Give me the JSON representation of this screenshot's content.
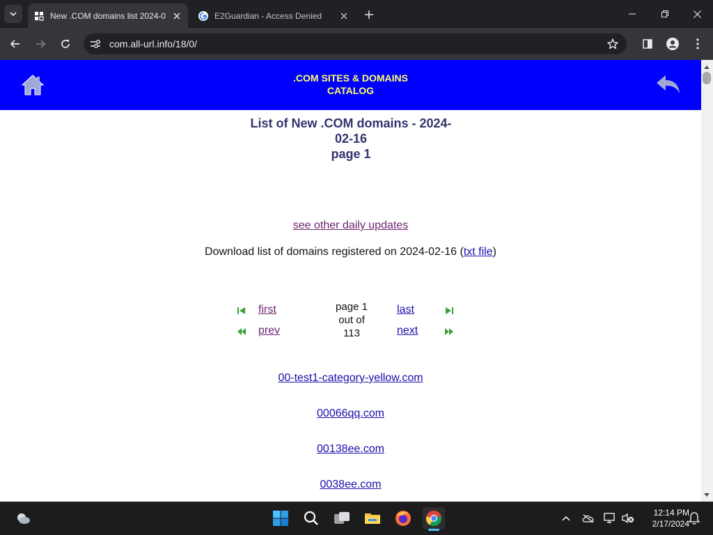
{
  "browser": {
    "tabs": [
      {
        "title": "New .COM domains list 2024-0",
        "favicon": "page-grid-icon",
        "active": true
      },
      {
        "title": "E2Guardian - Access Denied",
        "favicon": "google-g-icon",
        "active": false
      }
    ],
    "url": "com.all-url.info/18/0/"
  },
  "page": {
    "banner": {
      "title_line1": ".COM SITES & DOMAINS",
      "title_line2": "CATALOG",
      "left_icon": "home-icon",
      "right_icon": "back-arrow-icon"
    },
    "heading": {
      "line1": "List of New .COM domains - 2024-",
      "line2": "02-16",
      "line3": "page 1"
    },
    "daily_updates_link": "see other daily updates",
    "download": {
      "prefix": "Download list of domains registered on 2024-02-16 (",
      "link": "txt file",
      "suffix": ")"
    },
    "pager": {
      "first": "first",
      "prev": "prev",
      "last": "last",
      "next": "next",
      "info_line1": "page 1",
      "info_line2": "out of",
      "info_line3": "113"
    },
    "domains": [
      "00-test1-category-yellow.com",
      "00066qq.com",
      "00138ee.com",
      "0038ee.com"
    ]
  },
  "taskbar": {
    "apps": [
      "start-icon",
      "search-icon",
      "task-view-icon",
      "file-explorer-icon",
      "firefox-icon",
      "chrome-icon"
    ],
    "time": "12:14 PM",
    "date": "2/17/2024"
  },
  "colors": {
    "banner_bg": "#0000ff",
    "banner_text": "#ffff66",
    "heading": "#33336f",
    "link": "#1a0dab",
    "visited_link": "#6b2370",
    "pager_arrow": "#3aa13a"
  }
}
